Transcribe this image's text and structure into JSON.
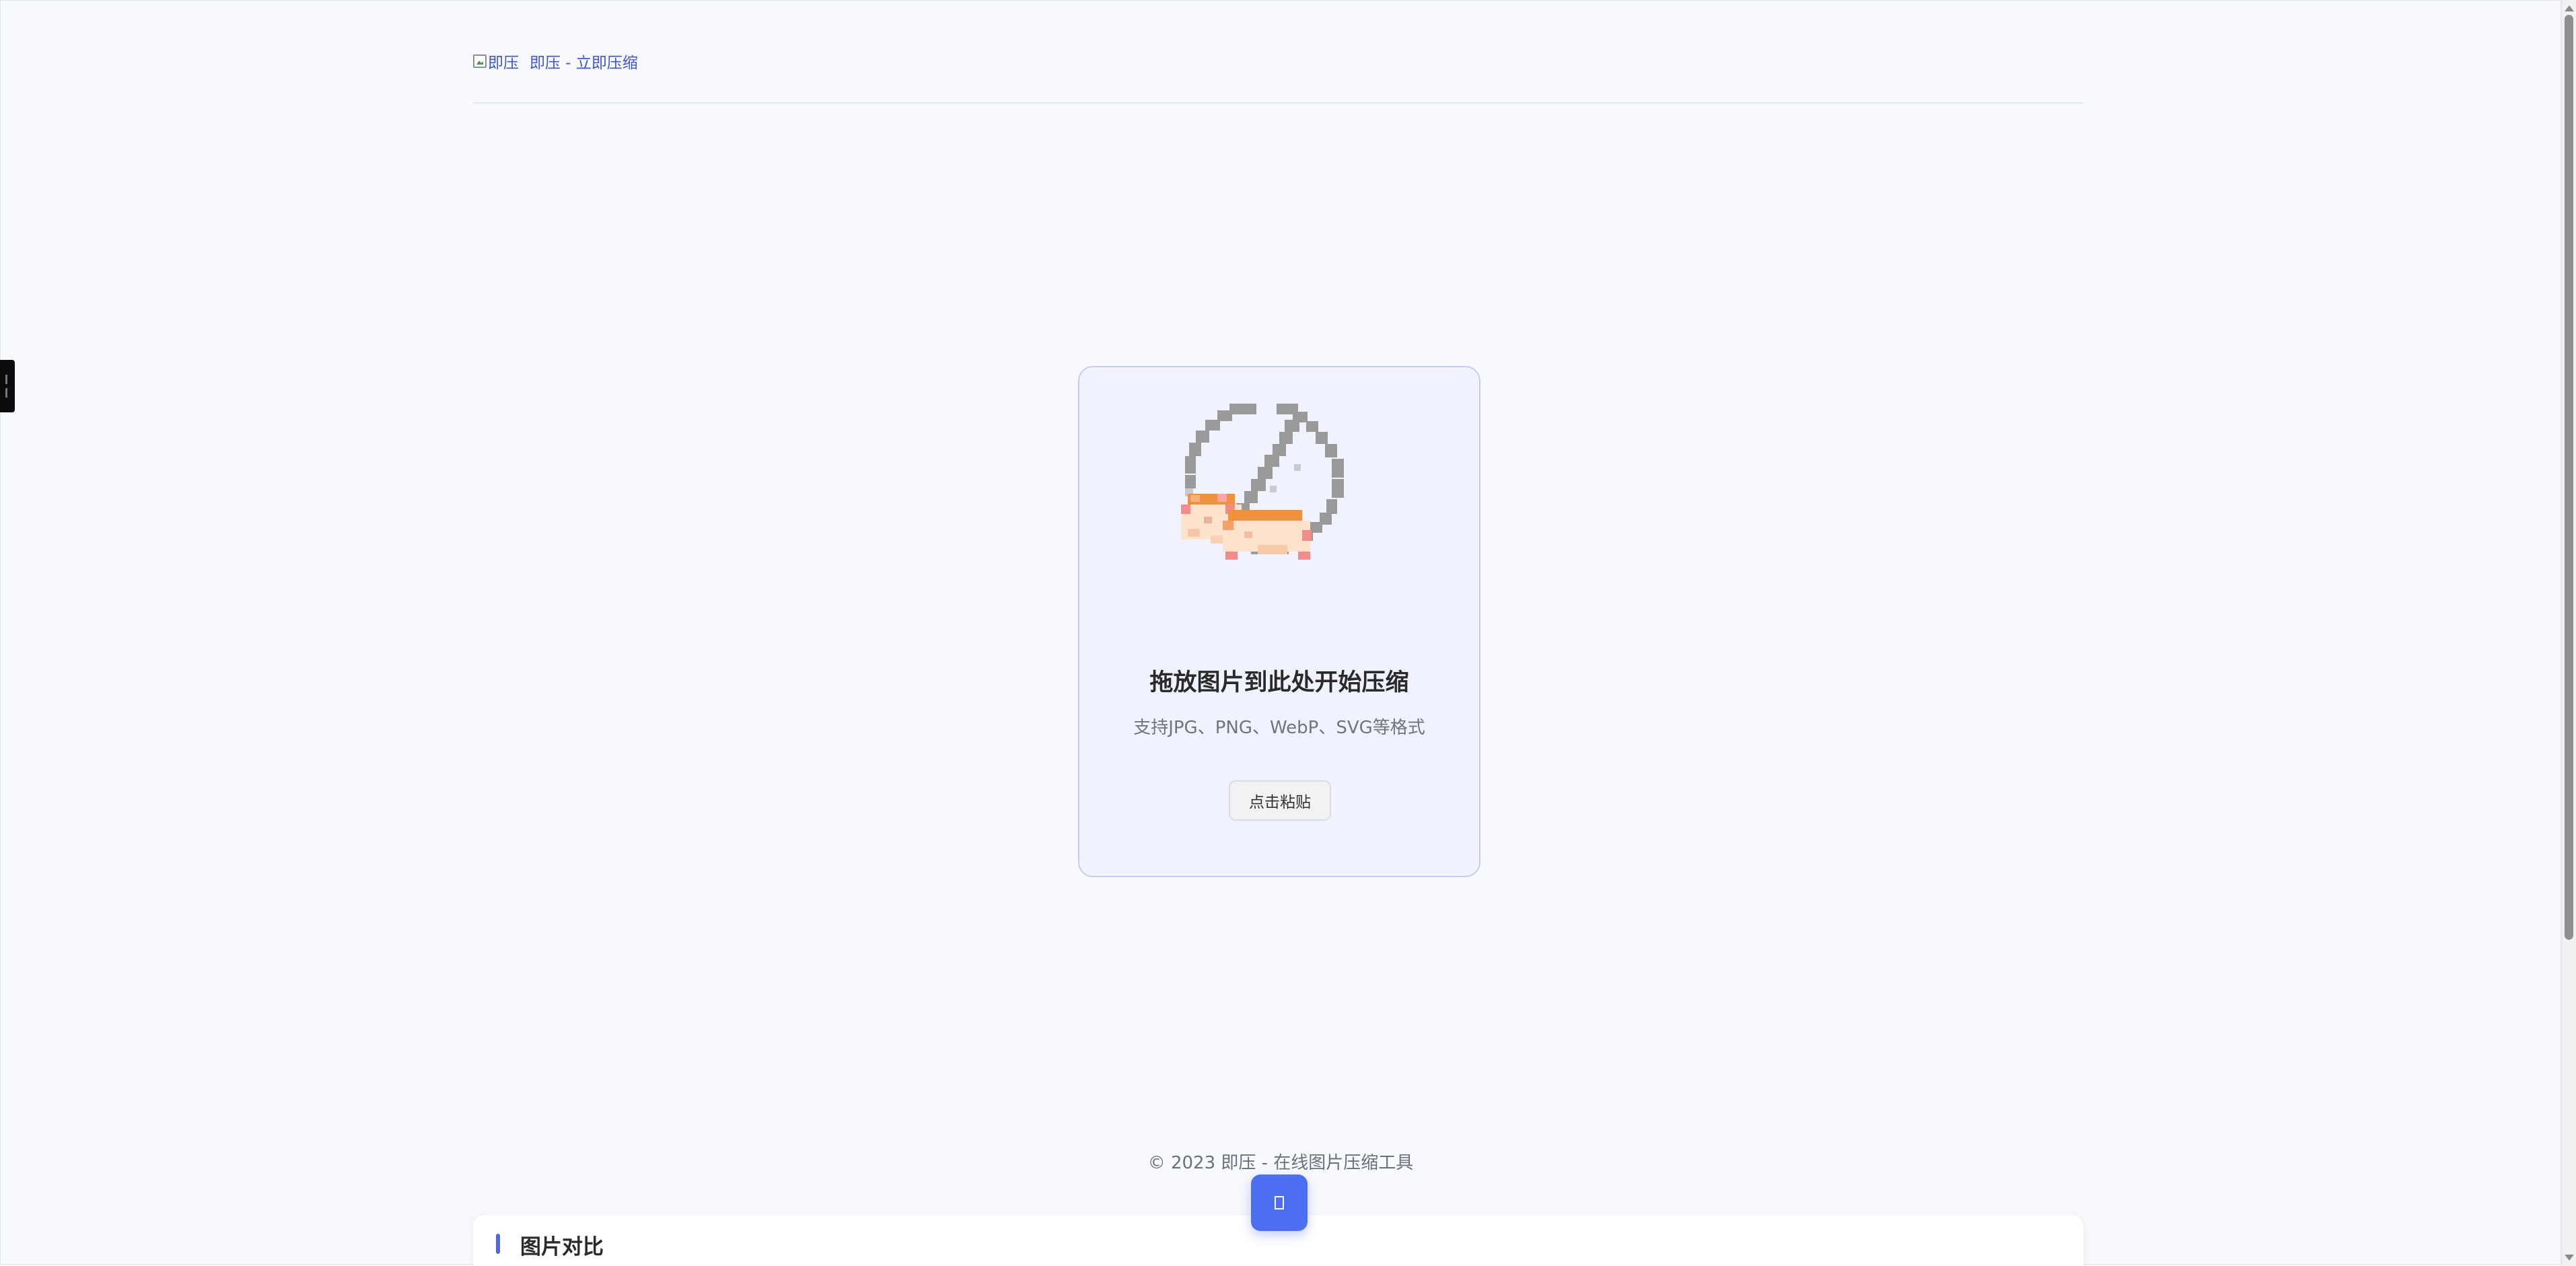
{
  "header": {
    "logo_alt": "即压",
    "site_title": "即压 - 立即压缩"
  },
  "upload": {
    "title": "拖放图片到此处开始压缩",
    "subtitle": "支持JPG、PNG、WebP、SVG等格式",
    "paste_button_label": "点击粘贴",
    "illustration_icon": "no-image-pixel-art-icon"
  },
  "footer": {
    "copyright": "© 2023 即压 - 在线图片压缩工具"
  },
  "compare_panel": {
    "title": "图片对比"
  },
  "fab": {
    "icon": "phone-icon"
  },
  "colors": {
    "accent": "#4c6ef0",
    "link": "#3d55d8",
    "background": "#f8f9fd",
    "card_background": "#f0f2fd",
    "card_border": "#c6ccf0"
  }
}
